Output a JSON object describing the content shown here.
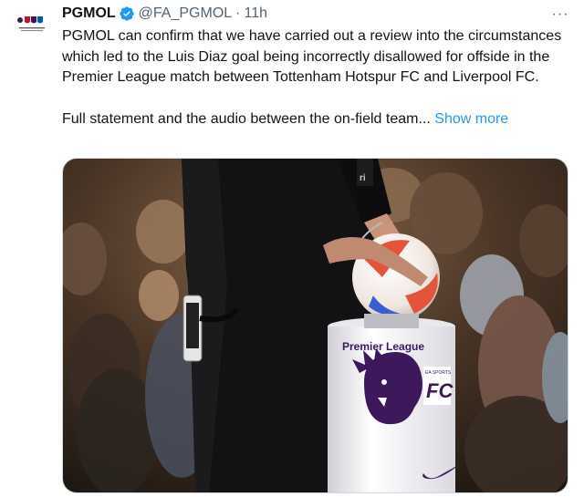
{
  "tweet": {
    "author_name": "PGMOL",
    "handle": "@FA_PGMOL",
    "separator": "·",
    "time": "11h",
    "text_main": "PGMOL can confirm that we have carried out a review into the circumstances which led to the Luis Diaz goal being incorrectly disallowed for offside in the Premier League match between Tottenham Hotspur FC and Liverpool FC.",
    "text_summary": "Full statement and the audio between the on-field team...",
    "show_more_label": "Show more",
    "more_icon": "···"
  },
  "media": {
    "description_icon": "photo",
    "podium_label": "Premier League",
    "podium_badge": "EA SPORTS FC"
  },
  "colors": {
    "link": "#1d9bf0",
    "verified": "#1d9bf0",
    "secondary_text": "#536471"
  }
}
